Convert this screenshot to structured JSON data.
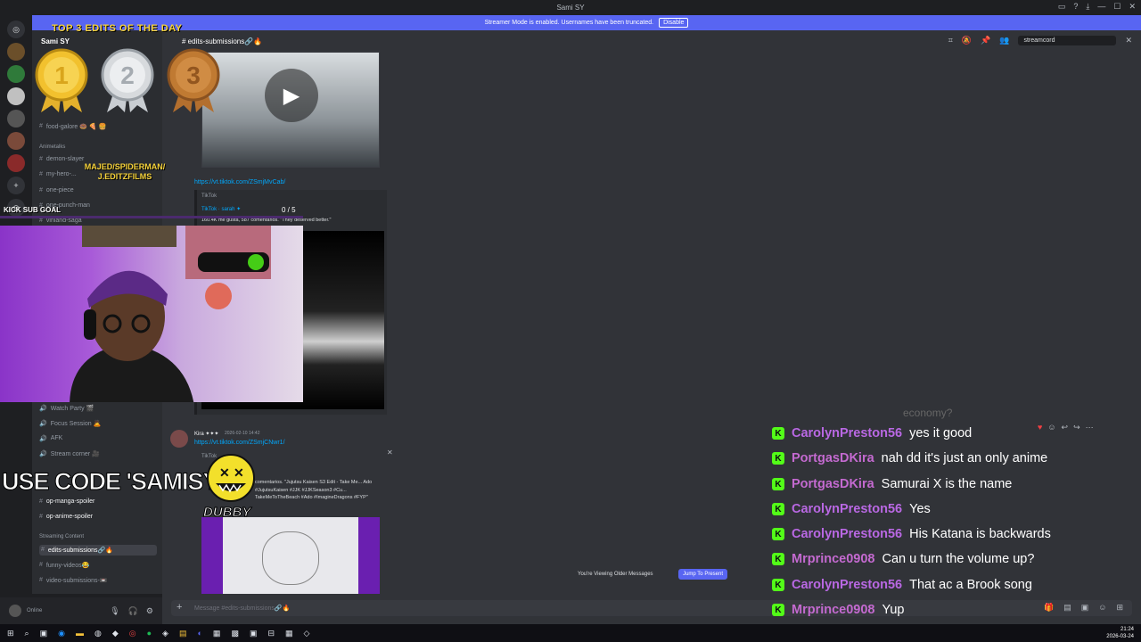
{
  "window": {
    "title": "Sami SY",
    "controls": [
      "minimize",
      "maximize",
      "close"
    ]
  },
  "banner": {
    "text": "Streamer Mode is enabled. Usernames have been truncated.",
    "button": "Disable"
  },
  "server": {
    "name": "Sami SY"
  },
  "sidebar": {
    "channels_top": [
      {
        "label": "food-galore 🍩 🍕 🍔",
        "top": 0
      }
    ],
    "category_animetalks": "Animetalks",
    "anime_channels": [
      "demon-slayer",
      "my-hero-...",
      "one-piece",
      "one-punch-man",
      "vinland-saga"
    ],
    "voice_channels": [
      "Watch Party 🎬",
      "Focus Session 🙇",
      "AFK",
      "Stream corner 🎥"
    ],
    "spoiler_channels": [
      "op-manga-spoiler",
      "op-anime-spoiler"
    ],
    "category_streaming": "Streaming Content",
    "streaming_channels": [
      "edits-submissions🔗🔥",
      "funny-videos😂",
      "video-submissions-📼"
    ],
    "user_status": "Online"
  },
  "channel": {
    "name": "edits-submissions🔗🔥",
    "search_placeholder": "streamcord"
  },
  "messages": {
    "link1": "https://vt.tiktok.com/ZSmjMvCab/",
    "provider": "TikTok",
    "author_line": "TikTok · sarah ✦",
    "page_counter": "0 / 5",
    "stats_line": "160.4K me gusta, 587 comentarios. \"They deserved better.\"",
    "msg2_author": "Kira ✦✦✦",
    "msg2_time": "2026-02-10 14:42",
    "link2": "https://vt.tiktok.com/ZSmjCNwr1/",
    "provider2": "TikTok",
    "embed2_text": "comentarios. \"Jujutsu Kaisen S3 Edit - Take Me... Ado #JujutsuKaisen #JJK #JJKSeason3 #Cu... TakeMeToTheBeach #Ado #ImagineDragons #FYP\""
  },
  "older_bar": {
    "text": "You're Viewing Older Messages",
    "button": "Jump To Present"
  },
  "composer": {
    "placeholder": "Message #edits-submissions🔗🔥"
  },
  "overlay": {
    "medal_title": "TOP 3 EDITS OF THE DAY",
    "medal_numbers": [
      "1",
      "2",
      "3"
    ],
    "credit": "MAJED/SPIDERMAN/ J.EDITZFILMS",
    "kick_goal": "KICK SUB GOAL",
    "code": "USE CODE 'SAMISY'",
    "sponsor": "DUBBY"
  },
  "chat": {
    "faded": "economy?",
    "rows": [
      {
        "user": "CarolynPreston56",
        "msg": "yes it good"
      },
      {
        "user": "PortgasDKira",
        "msg": "nah dd it's just an only anime"
      },
      {
        "user": "PortgasDKira",
        "msg": "Samurai X is the name"
      },
      {
        "user": "CarolynPreston56",
        "msg": "Yes"
      },
      {
        "user": "CarolynPreston56",
        "msg": "His Katana is backwards"
      },
      {
        "user": "Mrprince0908",
        "msg": "Can u turn the volume up?"
      },
      {
        "user": "CarolynPreston56",
        "msg": "That ac a Brook song"
      },
      {
        "user": "Mrprince0908",
        "msg": "Yup"
      }
    ]
  },
  "taskbar": {
    "time": "21:24",
    "date": "2026-03-24"
  },
  "colors": {
    "blurple": "#5865f2",
    "kick_green": "#53fc18",
    "chat_name": "#c46ad0"
  }
}
